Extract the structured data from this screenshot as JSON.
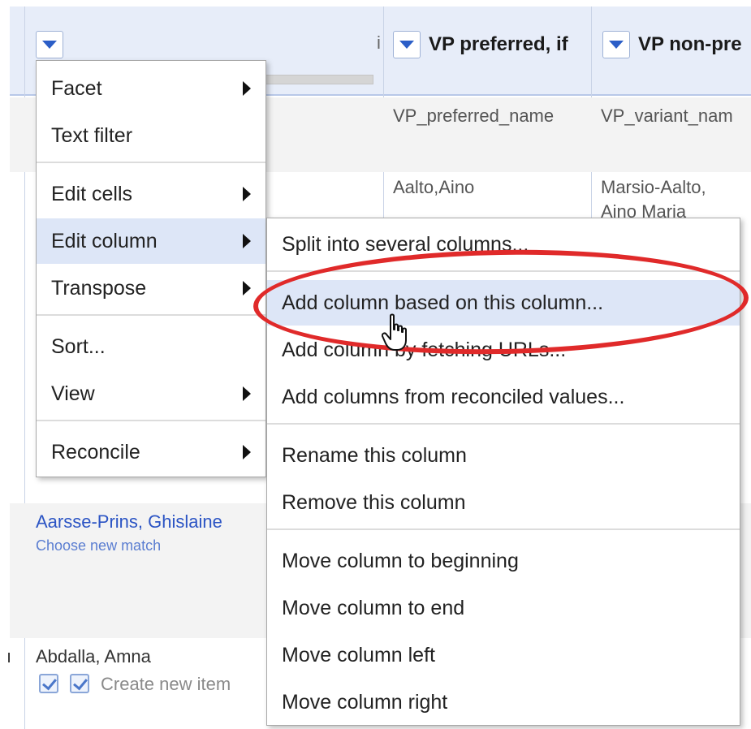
{
  "header": {
    "columns": [
      {
        "title": "",
        "truncated_marker": "i"
      },
      {
        "title": "VP preferred, if"
      },
      {
        "title": "VP non-pre"
      }
    ]
  },
  "rows": [
    {
      "col2": "VP_preferred_name",
      "col3": "VP_variant_nam"
    },
    {
      "col2": "Aalto,Aino",
      "col3_line1": "Marsio-Aalto,",
      "col3_line2": "Aino Maria"
    }
  ],
  "cells": {
    "match_name": "Aarsse-Prins, Ghislaine",
    "match_action": "Choose new match",
    "candidate_name": "Abdalla, Amna",
    "create_label": "Create new item",
    "row_marker": "ı"
  },
  "main_menu": {
    "items": [
      {
        "label": "Facet",
        "submenu": true
      },
      {
        "label": "Text filter",
        "submenu": false
      },
      {
        "label": "Edit cells",
        "submenu": true
      },
      {
        "label": "Edit column",
        "submenu": true
      },
      {
        "label": "Transpose",
        "submenu": true
      },
      {
        "label": "Sort...",
        "submenu": false
      },
      {
        "label": "View",
        "submenu": true
      },
      {
        "label": "Reconcile",
        "submenu": true
      }
    ]
  },
  "sub_menu": {
    "items": [
      {
        "label": "Split into several columns..."
      },
      {
        "label": "Add column based on this column..."
      },
      {
        "label": "Add column by fetching URLs..."
      },
      {
        "label": "Add columns from reconciled values..."
      },
      {
        "label": "Rename this column"
      },
      {
        "label": "Remove this column"
      },
      {
        "label": "Move column to beginning"
      },
      {
        "label": "Move column to end"
      },
      {
        "label": "Move column left"
      },
      {
        "label": "Move column right"
      }
    ]
  },
  "colors": {
    "header_bg": "#e7edf9",
    "menu_hover": "#dde6f7",
    "link": "#2b54c4",
    "highlight_ring": "#e02a2a"
  },
  "icons": [
    "dropdown-triangle-icon",
    "submenu-arrow-icon",
    "checkmark-icon",
    "hand-cursor-icon"
  ]
}
